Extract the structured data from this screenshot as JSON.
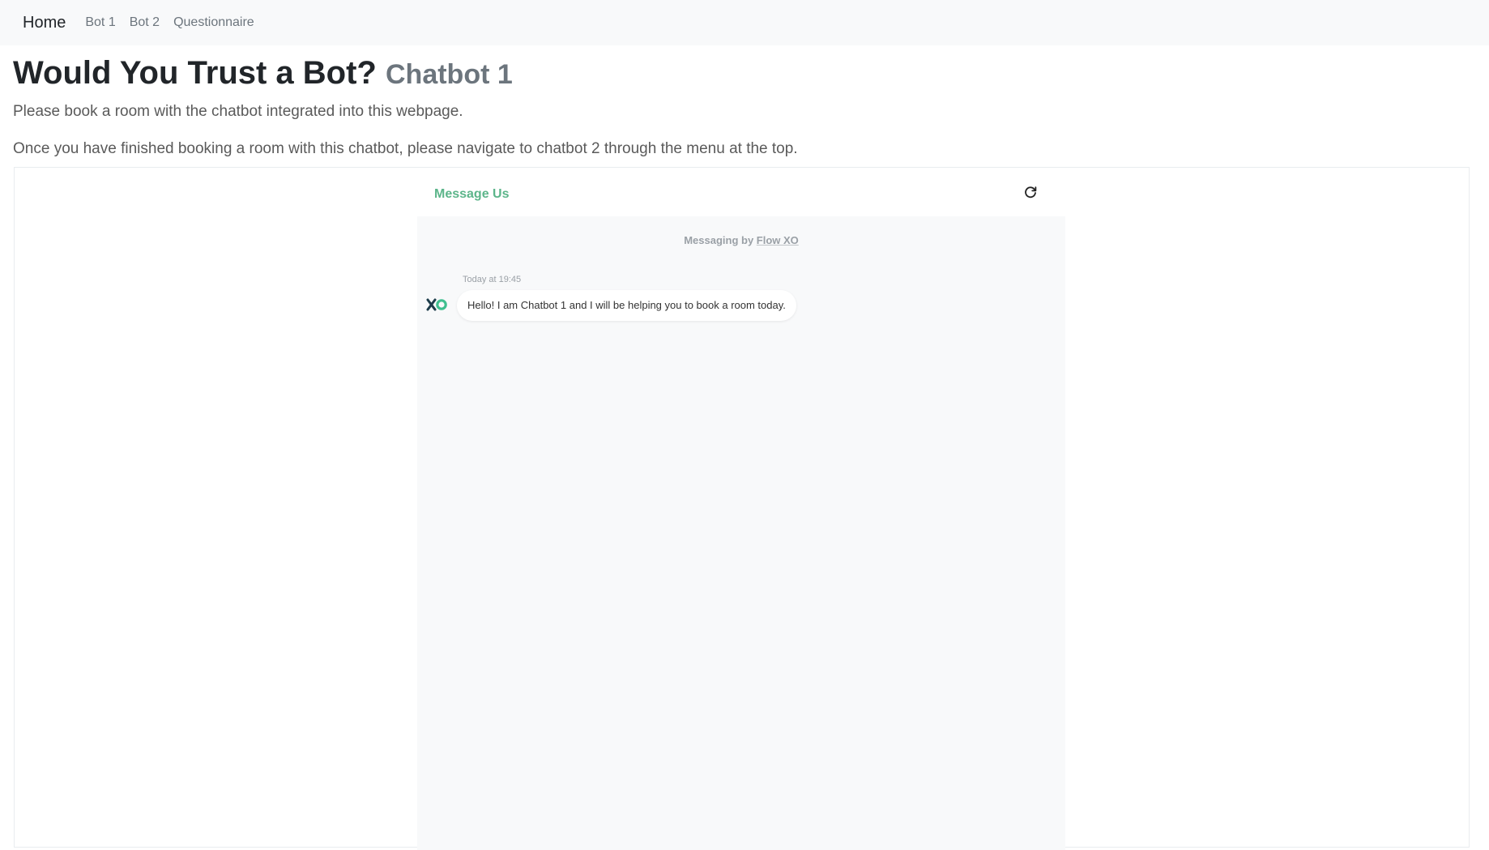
{
  "navbar": {
    "brand": "Home",
    "links": [
      "Bot 1",
      "Bot 2",
      "Questionnaire"
    ]
  },
  "page": {
    "title": "Would You Trust a Bot?",
    "subtitle": "Chatbot 1",
    "intro": "Please book a room with the chatbot integrated into this webpage.",
    "instruction": "Once you have finished booking a room with this chatbot, please navigate to chatbot 2 through the menu at the top."
  },
  "widget": {
    "header_title": "Message Us",
    "powered_prefix": "Messaging by ",
    "powered_brand": "Flow XO",
    "message": {
      "timestamp": "Today at 19:45",
      "text": "Hello! I am Chatbot 1 and I will be helping you to book a room today."
    },
    "icons": {
      "refresh": "refresh-icon",
      "avatar": "flowxo-logo-icon"
    },
    "colors": {
      "accent": "#5cb58a",
      "logo_dark": "#1d3c4a",
      "logo_green": "#3fbf8f",
      "panel_bg": "#f8f9fa"
    }
  }
}
